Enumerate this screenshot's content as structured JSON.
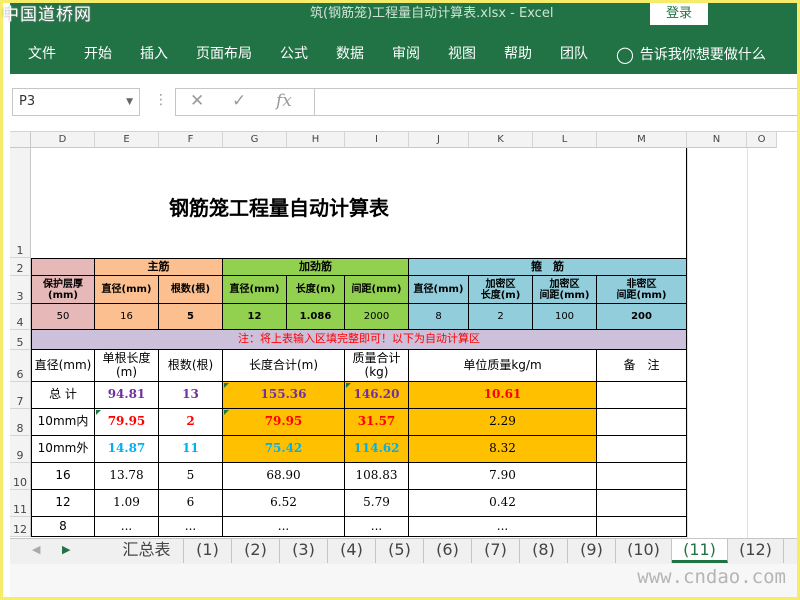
{
  "app": {
    "watermark_top": "中国道桥网",
    "window_title": "筑(钢筋笼)工程量自动计算表.xlsx - Excel",
    "login_label": "登录",
    "watermark_bottom": "www.cndao.com"
  },
  "ribbon": {
    "tabs": [
      "文件",
      "开始",
      "插入",
      "页面布局",
      "公式",
      "数据",
      "审阅",
      "视图",
      "帮助",
      "团队"
    ],
    "tell_me": "告诉我你想要做什么"
  },
  "formula_bar": {
    "name_box": "P3",
    "cancel_icon": "✕",
    "enter_icon": "✓",
    "fx_label": "fx",
    "formula": ""
  },
  "columns": [
    "D",
    "E",
    "F",
    "G",
    "H",
    "I",
    "J",
    "K",
    "L",
    "M",
    "N",
    "O"
  ],
  "rows": [
    "1",
    "2",
    "3",
    "4",
    "5",
    "6",
    "7",
    "8",
    "9",
    "10",
    "11",
    "12"
  ],
  "sheet": {
    "title": "钢筋笼工程量自动计算表",
    "groups": {
      "main": "主筋",
      "stiff": "加劲筋",
      "stirrup": "箍　筋"
    },
    "input_headers": [
      "保护层厚\n(mm)",
      "直径(mm)",
      "根数(根)",
      "直径(mm)",
      "长度(m)",
      "间距(mm)",
      "直径(mm)",
      "加密区\n长度(m)",
      "加密区\n间距(mm)",
      "非密区\n间距(mm)"
    ],
    "input_values": [
      "50",
      "16",
      "5",
      "12",
      "1.086",
      "2000",
      "8",
      "2",
      "100",
      "200"
    ],
    "note": "注：将上表输入区填完整即可！以下为自动计算区",
    "result_headers": [
      "直径(mm)",
      "单根长度\n(m)",
      "根数(根)",
      "长度合计(m)",
      "质量合计(kg)",
      "单位质量kg/m",
      "备　注"
    ],
    "result_rows": [
      [
        "总 计",
        "94.81",
        "13",
        "155.36",
        "146.20",
        "10.61",
        ""
      ],
      [
        "10mm内",
        "79.95",
        "2",
        "79.95",
        "31.57",
        "2.29",
        ""
      ],
      [
        "10mm外",
        "14.87",
        "11",
        "75.42",
        "114.62",
        "8.32",
        ""
      ],
      [
        "16",
        "13.78",
        "5",
        "68.90",
        "108.83",
        "7.90",
        ""
      ],
      [
        "12",
        "1.09",
        "6",
        "6.52",
        "5.79",
        "0.42",
        ""
      ],
      [
        "8",
        "...",
        "...",
        "...",
        "...",
        "...",
        ""
      ]
    ]
  },
  "colors": {
    "ribbon_green": "#217346",
    "pink_header": "#e6b8b7",
    "orange_header": "#fcbf8f",
    "green_header": "#92d050",
    "blue_header": "#92cddc",
    "purple_note": "#ccc0da",
    "total_highlight": "#ffc000",
    "purple_text": "#7030a0",
    "red_text": "#ff0000",
    "cyan_text": "#00b0f0"
  },
  "sheet_tabs": [
    "汇总表",
    "(1)",
    "(2)",
    "(3)",
    "(4)",
    "(5)",
    "(6)",
    "(7)",
    "(8)",
    "(9)",
    "(10)",
    "(11)",
    "(12)"
  ],
  "active_tab": "(11)"
}
